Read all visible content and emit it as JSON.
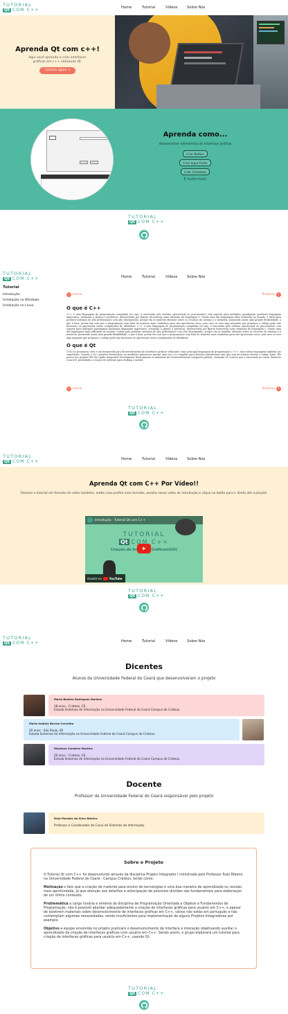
{
  "logo": {
    "line1": "TUTORIAL",
    "qt": "Qt",
    "line2": "COM C++"
  },
  "nav": {
    "home": "Home",
    "tutorial": "Tutorial",
    "videos": "Vídeos",
    "about": "Sobre Nós"
  },
  "hero": {
    "title": "Aprenda Qt com c++!",
    "subtitle": "Aqui você aprende a criar interfaces gráficas em c++ utilizando Qt.",
    "cta": "Comece agora"
  },
  "learn": {
    "title": "Aprenda como...",
    "subtitle": "desenvolver elementos de interface gráfica",
    "items": [
      "Criar Botões",
      "Criar Input Fields",
      "Criar Checkbox"
    ],
    "more": "E muito mais!"
  },
  "tutorial": {
    "sidebar_title": "Tutorial",
    "sidebar_items": [
      "Introdução",
      "Instalação no Windows",
      "Instalação no Linux"
    ],
    "prev": "Home",
    "next": "Próximo",
    "section1_title": "O que é C++",
    "section1_text": "C++ é uma linguagem de programação compilada (ou seja, é executada pelo sistema operacional ou processador) com suporte para múltiplos paradigmas (podendo linguagem imperativa, orientada a objetos e genérica), desenvolvida por Bjarne Stroustrup como extensão da linguagem C. Sendo uma das linguagens mais utilizadas no mundo, é ideal para produzir sistemas de alta performance com alto desempenho, porque ela se mantém eficiente sobre os recursos do sistema e a memória, possuindo assim uma grande flexibilidade, o que é bom, porém faz com que a programação seja feita de maneira mais cuidadosa para não apresentar erros, pois caso se erre algo ninguém que preparou o código pode não funcionar ou apresentar vários complicados de identificar. C++ é uma linguagem de programação compilada (ou seja, é executada pelo sistema operacional ou processador) com suporte para múltiplos paradigmas (incluindo linguagem imperativa, orientada a objetos e genérica), desenvolvida por Bjarne Stroustrup como extensão da linguagem C. Sendo uma das linguagens mais utilizadas no mundo, é ideal para produzir sistemas de alta performance com alto desempenho, porque ela se mantém eficiente sobre os recursos do sistema e a memória, possuindo assim uma grande flexibilidade, o que é bom, porém faz com que a programação seja feita de maneira mais cuidadosa para não apresentar erros, pois caso se erre algo ninguém que preparou o código pode não funcionar ou apresentar vários complicados de identificar.",
    "section2_title": "O que é Qt",
    "section2_text": "O Qt (se pronuncia cute) é um framework para desenvolvimento de interfaces gráficas utilizando como principal linguagem de programação o C++, mas outras linguagens também são suportadas. Usando o Qt é possível desenvolver ou modificar aplicativos apenas uma vez e os compilar para diversas plataformas sem que seja necessário alterar o código fonte. Ele possui seu próprio IDE (do inglês Integrated Development Environment ou Ambiente de Desenvolvimento Integrado) padrão, chamada Qt Creator, que é executado no Linux, Windows e macOS, permitindo a criação de software para desktop e mobile."
  },
  "videos": {
    "title": "Aprenda Qt com C++ Por Vídeo!!",
    "subtitle": "Fizemos o tutorial em formato de vídeo também, então caso prefira esse formato, assista nosso vídeo de introdução e clique no botão para ir direto até a playlist.",
    "video_title": "Introdução - Tutorial Qt com C++",
    "thumb_line1": "TUTORIAL",
    "thumb_qt": "Qt",
    "thumb_line2": "COM C++",
    "thumb_caption": "Criação de Interface Gráficas(GUI)",
    "watch_on": "Assistir no",
    "youtube": "YouTube"
  },
  "about": {
    "docentes_title": "Dicentes",
    "docentes_subtitle": "Alunos da Universidade Federal do Ceará que desenvolveram o projeto",
    "students": [
      {
        "name": "Maria Beatriz Rodrigues Martins",
        "line1": "18 anos - Crateús, CE.",
        "line2": "Estuda Sistemas de Informação na Universidade Federal do Ceará Campus de Crateús.",
        "color": "#fdd6d6"
      },
      {
        "name": "Maria Isabely Barros Carvalho",
        "line1": "20 anos - São Paulo, SP.",
        "line2": "Estuda Sistemas de Informação na Universidade Federal do Ceará Campus de Crateús.",
        "color": "#d4ecfb"
      },
      {
        "name": "Montoya Cordeiro Martins",
        "line1": "20 anos - Crateús, CE.",
        "line2": "Estuda Sistemas de Informação na Universidade Federal do Ceará Campus de Crateús.",
        "color": "#e3d5f7"
      }
    ],
    "docente_title": "Docente",
    "docente_subtitle": "Professor da Universidade Federal do Ceará responsável pelo projeto",
    "teacher": {
      "name": "Ítalo Mendes da Silva Ribeiro",
      "line1": "Professor e Coordenador do Curso de Sistemas de Informação.",
      "color": "#fff0d3"
    },
    "project_title": "Sobre o Projeto",
    "project_intro": "O Tutorial Qt com C++ foi desenvolvido através da disciplina Projeto Integrador I ministrada pelo Professor Ítalo Ribeiro na Universidade Federal do Ceará - Campus Crateús, tendo como:",
    "motivation_label": "Motivação",
    "motivation_text": " o fato que a criação de material para ensino de tecnologias é uma boa maneira de aprendizado ou revisão mais aprofundada, já que atenção aos detalhes e antecipação de possíveis dúvidas são fundamentais para elaboração de um ótimo conteúdo.",
    "problem_label": "Problemática",
    "problem_text": " a carga horária e ementa da disciplina de Programação Orientada a Objetos e Fundamentos de Programação, não é possível abordar adequadamente a criação de interfaces gráficas para usuário em C++, e apesar de existirem materiais sobre desenvolvimento de interfaces gráficas em C++, vários não estão em português e não contemplam algumas necessidades, sendo insuficientes para implementação de alguns Projetos Integradores por exemplo.",
    "goal_label": "Objetivo",
    "goal_text": " a equipe envolvida no projeto praticará o desenvolvimento de interface e interação objetivando auxiliar o aprendizado da criação de interfaces gráficas com usuário em C++. Sendo assim, o grupo elaborará um tutorial para criação de interfaces gráficas para usuário em C++, usando Qt."
  },
  "colors": {
    "teal": "#4fb9a1",
    "orange": "#ef7560",
    "cream": "#fdf0d4"
  }
}
